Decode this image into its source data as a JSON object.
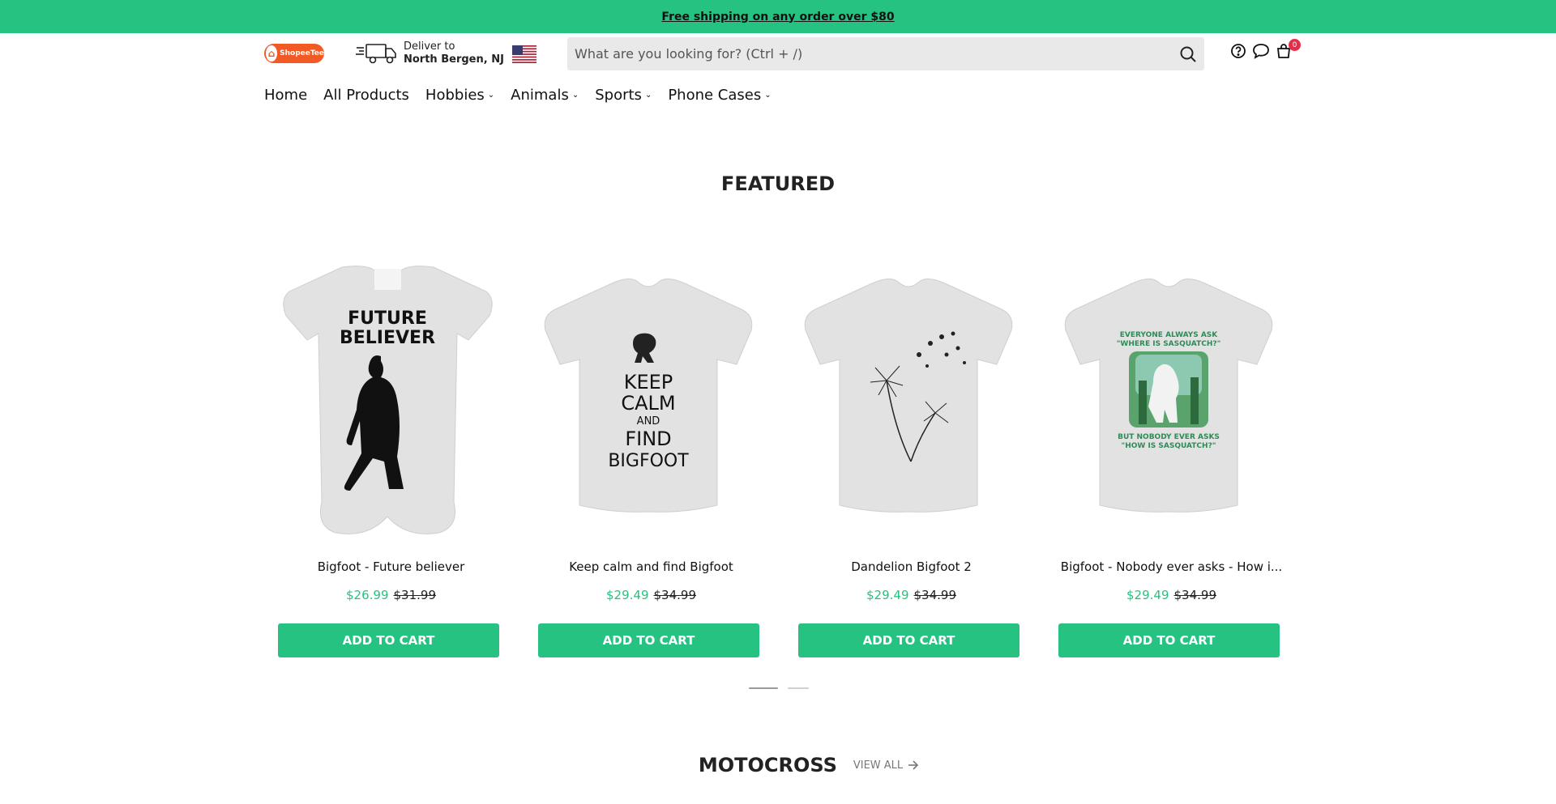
{
  "announcement": "Free shipping on any order over $80",
  "logo": {
    "text": "ShopeeTee"
  },
  "deliver": {
    "line1": "Deliver to",
    "line2": "North Bergen, NJ"
  },
  "search": {
    "placeholder": "What are you looking for? (Ctrl + /)"
  },
  "header_icons": {
    "help": "help-icon",
    "chat": "chat-icon",
    "cart": "cart-icon",
    "cart_count": "0"
  },
  "nav": [
    {
      "label": "Home",
      "dropdown": false
    },
    {
      "label": "All Products",
      "dropdown": false
    },
    {
      "label": "Hobbies",
      "dropdown": true
    },
    {
      "label": "Animals",
      "dropdown": true
    },
    {
      "label": "Sports",
      "dropdown": true
    },
    {
      "label": "Phone Cases",
      "dropdown": true
    }
  ],
  "featured": {
    "title": "FEATURED",
    "products": [
      {
        "name": "Bigfoot - Future believer",
        "price": "$26.99",
        "original_price": "$31.99",
        "button": "ADD TO CART",
        "print_text": [
          "FUTURE",
          "BELIEVER"
        ]
      },
      {
        "name": "Keep calm and find Bigfoot",
        "price": "$29.49",
        "original_price": "$34.99",
        "button": "ADD TO CART",
        "print_text": [
          "KEEP",
          "CALM",
          "AND",
          "FIND",
          "BIGFOOT"
        ]
      },
      {
        "name": "Dandelion Bigfoot 2",
        "price": "$29.49",
        "original_price": "$34.99",
        "button": "ADD TO CART",
        "print_text": []
      },
      {
        "name": "Bigfoot - Nobody ever asks - How i...",
        "price": "$29.49",
        "original_price": "$34.99",
        "button": "ADD TO CART",
        "print_text": [
          "EVERYONE ALWAYS ASK",
          "\"WHERE IS SASQUATCH?\"",
          "BUT NOBODY EVER ASKS",
          "\"HOW IS SASQUATCH?\""
        ]
      }
    ],
    "slider_pages": 2,
    "slider_active": 1
  },
  "motocross": {
    "title": "MOTOCROSS",
    "view_all": "VIEW ALL"
  },
  "colors": {
    "accent": "#26c281",
    "badge": "#e0314b",
    "logo": "#f15a24"
  }
}
